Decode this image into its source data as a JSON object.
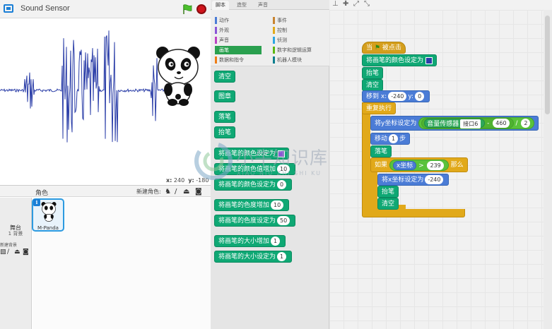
{
  "stage": {
    "title": "Sound Sensor",
    "coord_x_label": "x:",
    "coord_x": "240",
    "coord_y_label": "y:",
    "coord_y": "-180",
    "sprite_caption": "M-Panda"
  },
  "sprites_pane": {
    "label": "角色",
    "new_sprite_label": "新建角色:",
    "stage_label": "舞台",
    "backdrop_count": "1 背景",
    "new_backdrop_label": "新建背景",
    "selected_sprite_name": "M-Panda"
  },
  "tabs": [
    "脚本",
    "造型",
    "声音"
  ],
  "categories": {
    "left": [
      {
        "label": "动作",
        "color": "#4b7cd6"
      },
      {
        "label": "外观",
        "color": "#8a55d7"
      },
      {
        "label": "声音",
        "color": "#bb42c3"
      },
      {
        "label": "画笔",
        "color": "#0fa874",
        "active": true
      },
      {
        "label": "数据和指令",
        "color": "#ee7d16"
      }
    ],
    "right": [
      {
        "label": "事件",
        "color": "#c88330"
      },
      {
        "label": "控制",
        "color": "#e1a91a"
      },
      {
        "label": "侦测",
        "color": "#2ca5e2"
      },
      {
        "label": "数字和逻辑运算",
        "color": "#5cb712"
      },
      {
        "label": "机器人模块",
        "color": "#0d7f8f"
      }
    ]
  },
  "palette_blocks": {
    "clear": "清空",
    "stamp": "图章",
    "pen_down": "落笔",
    "pen_up": "抬笔",
    "set_color": "将画笔的颜色设定为",
    "change_color": "将画笔的颜色值增加",
    "change_color_value": "10",
    "set_color_value": "将画笔的颜色设定为",
    "set_color_value_num": "0",
    "change_shade": "将画笔的色度增加",
    "change_shade_value": "10",
    "set_shade": "将画笔的色度设定为",
    "set_shade_value": "50",
    "change_size": "将画笔的大小增加",
    "change_size_value": "1",
    "set_size": "将画笔的大小设定为",
    "set_size_value": "1"
  },
  "script": {
    "hat_prefix": "当",
    "hat_suffix": "被点击",
    "set_pen_color": "将画笔的颜色设定为",
    "pen_up": "抬笔",
    "clear": "清空",
    "goto_label": "移到 x:",
    "goto_x": "-240",
    "goto_y_label": "y:",
    "goto_y": "0",
    "forever": "重复执行",
    "set_y": "将y坐标设定为",
    "sensor": "音量传感器",
    "port": "接口6",
    "minus_value": "460",
    "div_value": "2",
    "move": "移动",
    "move_steps": "1",
    "move_unit": "步",
    "pen_down": "落笔",
    "if": "如果",
    "x_pos": "x坐标",
    "compare_value": "239",
    "then": "那么",
    "set_x": "将x坐标设定为",
    "set_x_value": "-240",
    "pen_up2": "抬笔",
    "clear2": "清空"
  },
  "watermark": {
    "text": "小牛知识库",
    "sub": "XIAO NIU ZHI SHI KU"
  },
  "colors": {
    "pen_category": "#0fa874",
    "events": "#d59f1d",
    "control": "#e1a91a",
    "motion": "#4b7cd6",
    "sensor": "#2fa85a",
    "operators": "#5ac23b",
    "stage_plot": "#2b3ea8",
    "pen_color_swatch": "#2b3ea8"
  }
}
